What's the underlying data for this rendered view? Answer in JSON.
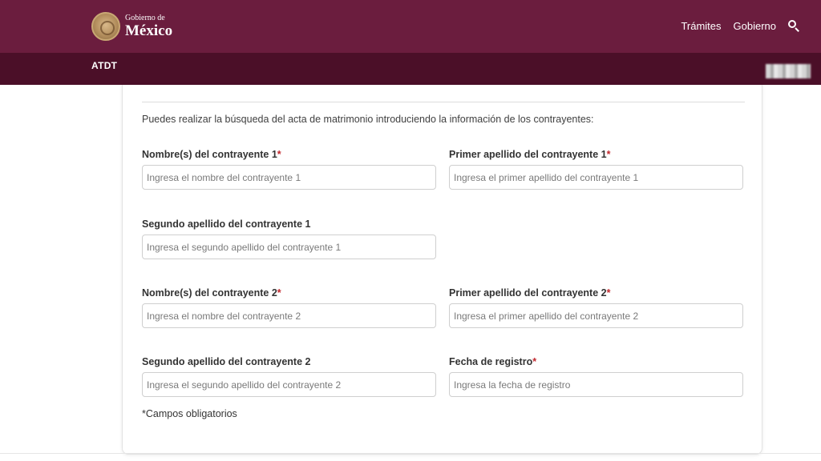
{
  "header": {
    "logo_small": "Gobierno de",
    "logo_big": "México",
    "nav": [
      "Trámites",
      "Gobierno"
    ],
    "search_icon": "search-icon"
  },
  "subheader": {
    "title": "ATDT"
  },
  "colors": {
    "primary": "#6b1d3e",
    "secondary": "#4b0f28",
    "required": "#c1272d"
  },
  "form": {
    "intro": "Puedes realizar la búsqueda del acta de matrimonio introduciendo la información de los contrayentes:",
    "fields": [
      {
        "label": "Nombre(s) del contrayente 1",
        "required": "*",
        "placeholder": "Ingresa el nombre del contrayente 1"
      },
      {
        "label": "Primer apellido del contrayente 1",
        "required": "*",
        "placeholder": "Ingresa el primer apellido del contrayente 1"
      },
      {
        "label": "Segundo apellido del contrayente 1",
        "required": "",
        "placeholder": "Ingresa el segundo apellido del contrayente 1"
      },
      {
        "label": "Nombre(s) del contrayente 2",
        "required": "*",
        "placeholder": "Ingresa el nombre del contrayente 2"
      },
      {
        "label": "Primer apellido del contrayente 2",
        "required": "*",
        "placeholder": "Ingresa el primer apellido del contrayente 2"
      },
      {
        "label": "Segundo apellido del contrayente 2",
        "required": "",
        "placeholder": "Ingresa el segundo apellido del contrayente 2"
      },
      {
        "label": "Fecha de registro",
        "required": "*",
        "placeholder": "Ingresa la fecha de registro"
      }
    ],
    "note": "*Campos obligatorios"
  }
}
